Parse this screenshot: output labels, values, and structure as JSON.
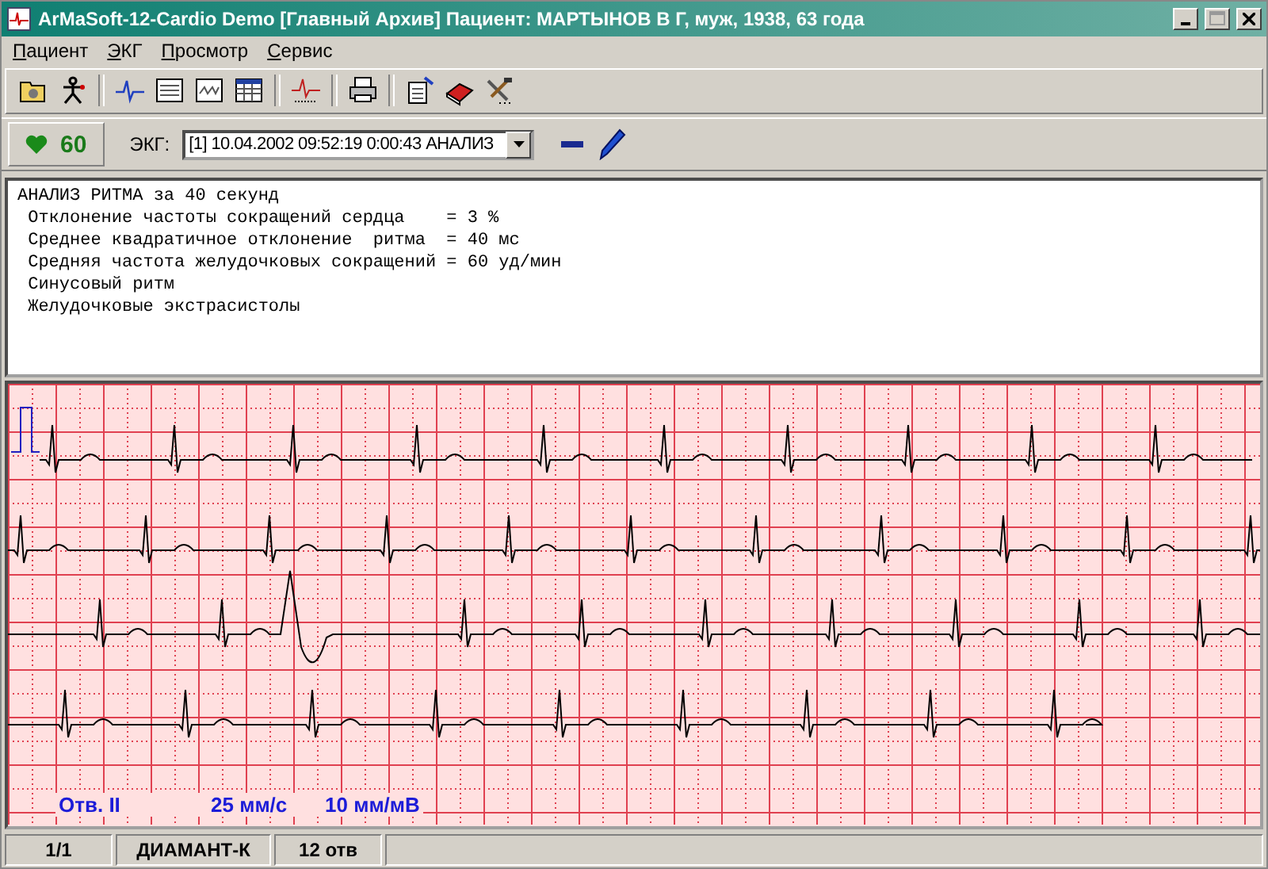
{
  "window": {
    "title": "ArMaSoft-12-Cardio Demo [Главный Архив]  Пациент: МАРТЫНОВ В Г,  муж,  1938,  63 года"
  },
  "menu": [
    "Пациент",
    "ЭКГ",
    "Просмотр",
    "Сервис"
  ],
  "heart_rate": "60",
  "ecg_selector": {
    "label": "ЭКГ:",
    "value": "[1] 10.04.2002 09:52:19  0:00:43 АНАЛИЗ"
  },
  "report": [
    "АНАЛИЗ РИТМА за 40 секунд",
    " Отклонение частоты сокращений сердца    = 3 %",
    " Среднее квадратичное отклонение  ритма  = 40 мс",
    " Средняя частота желудочковых сокращений = 60 уд/мин",
    " Синусовый ритм",
    " Желудочковые экстрасистолы"
  ],
  "ecg": {
    "lead": "Отв. II",
    "speed": "25 мм/с",
    "gain": "10 мм/мВ"
  },
  "status_bar": [
    "1/1",
    "ДИАМАНТ-К",
    "12 отв"
  ]
}
